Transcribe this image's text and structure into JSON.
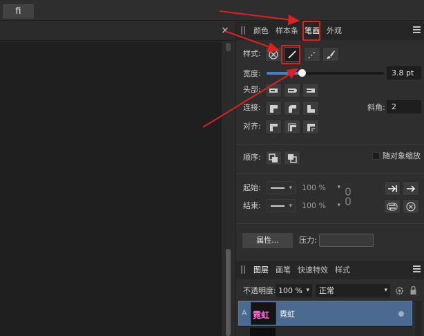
{
  "toolbar": {
    "fi_label": "fi"
  },
  "document": {
    "close_glyph": "×"
  },
  "stroke_panel": {
    "tabs": [
      "颜色",
      "样本条",
      "笔画",
      "外观"
    ],
    "active_tab": "笔画",
    "style_label": "样式:",
    "width_label": "宽度:",
    "width_value": "3.8 pt",
    "width_fraction": 0.3,
    "cap_label": "头部:",
    "join_label": "连接:",
    "miter_label": "斜角:",
    "miter_value": "2",
    "align_label": "对齐:",
    "order_label": "顺序:",
    "scale_with_object_label": "随对象缩放",
    "start_label": "起始:",
    "end_label": "结束:",
    "start_scale": "100 %",
    "end_scale": "100 %",
    "properties_button": "属性...",
    "pressure_label": "压力:"
  },
  "layers_panel": {
    "tabs": [
      "图层",
      "画笔",
      "快速特效",
      "样式"
    ],
    "active_tab": "图层",
    "opacity_label": "不透明度:",
    "opacity_value": "100 %",
    "blend_mode": "正常",
    "layer_letter": "A",
    "layer_thumb_text": "霓虹",
    "layer_name": "霓虹"
  },
  "colors": {
    "annotation": "#e02020",
    "slider_fill": "#4a7fc4",
    "selected_row": "#4a6a8f",
    "thumb_text": "#ff6fd3"
  },
  "icons": [
    "close-icon",
    "no-stroke-icon",
    "solid-line-icon",
    "dashed-line-icon",
    "brush-stroke-icon",
    "menu-icon",
    "settings-icon",
    "lock-icon",
    "link-icon"
  ]
}
